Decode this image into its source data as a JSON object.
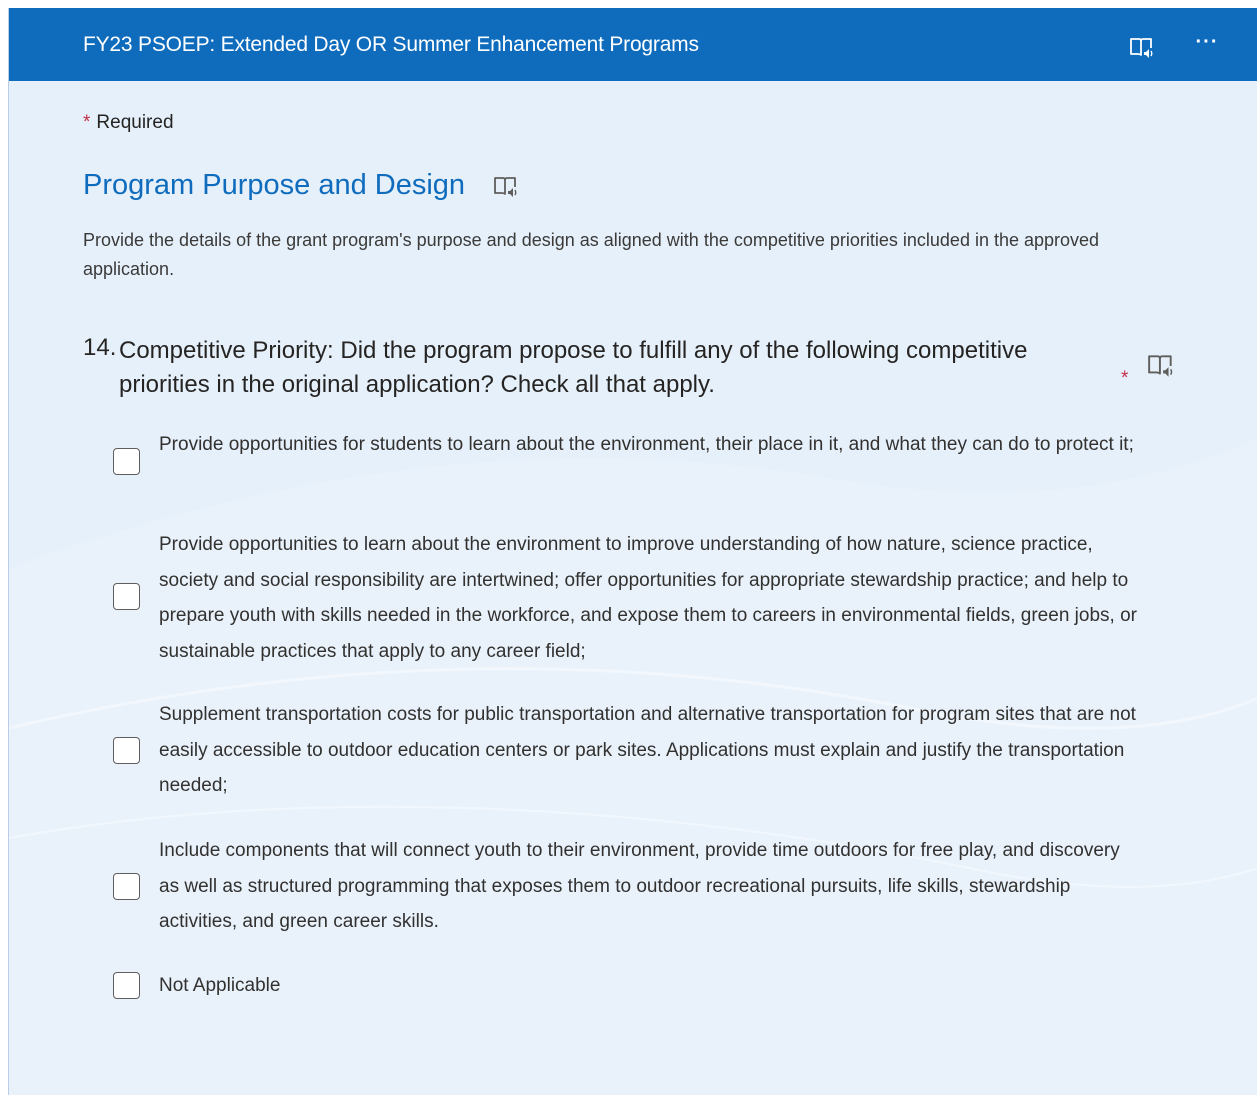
{
  "header": {
    "title": "FY23 PSOEP: Extended Day OR Summer Enhancement Programs",
    "reader_icon": "immersive-reader-icon",
    "more_icon": "more-options-icon",
    "more_glyph": "···"
  },
  "required_note": {
    "star": "*",
    "text": "Required"
  },
  "section": {
    "title": "Program Purpose and Design",
    "description": "Provide the details of the grant program's purpose and design as aligned with the competitive priorities included in the approved application."
  },
  "question": {
    "number": "14.",
    "text": "Competitive Priority: Did the program propose to fulfill any of the following competitive priorities in the original application? Check all that apply.",
    "required_star": "*",
    "options": [
      {
        "label": "Provide opportunities for students to learn about the environment, their place in it, and what they can do to protect it;",
        "checked": false
      },
      {
        "label": "Provide opportunities to learn about the environment to improve understanding of how nature, science practice, society and social responsibility are intertwined; offer opportunities for appropriate stewardship practice; and help to prepare youth with skills needed in the workforce, and expose them to careers in environmental fields, green jobs, or sustainable practices that apply to any career field;",
        "checked": false
      },
      {
        "label": "Supplement transportation costs for public transportation and alternative transportation for program sites that are not easily accessible to outdoor education centers or park sites. Applications must explain and justify the transportation needed;",
        "checked": false
      },
      {
        "label": "Include components that will connect youth to their environment, provide time outdoors for free play, and discovery as well as structured programming that exposes them to outdoor recreational pursuits, life skills, stewardship activities, and green career skills.",
        "checked": false
      },
      {
        "label": "Not Applicable",
        "checked": false
      }
    ]
  },
  "colors": {
    "header_bg": "#0f6cbd",
    "page_bg": "#e6f0fa",
    "accent": "#0f6cbd",
    "required": "#c4314b"
  }
}
